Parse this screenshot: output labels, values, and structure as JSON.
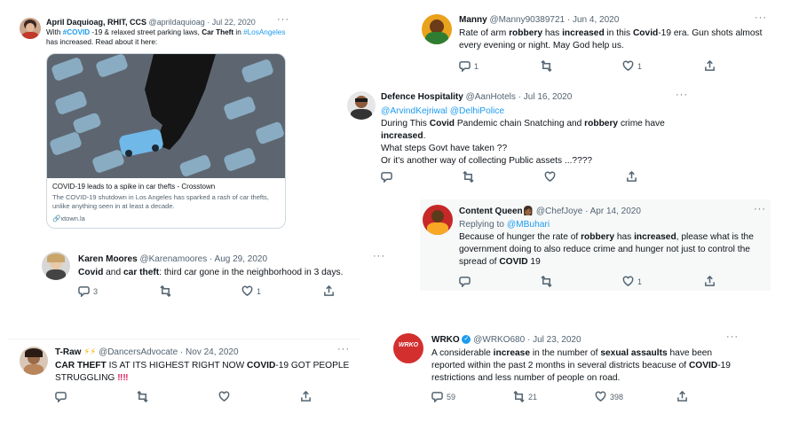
{
  "tweets": {
    "april": {
      "name": "April Daquioag, RHIT, CCS",
      "meta": "@aprildaquioag · Jul 22, 2020",
      "t1": "With ",
      "hashtag1": "#COVID",
      "t2": " -19 & relaxed street parking laws, ",
      "b1": "Car Theft",
      "t3": " in ",
      "hashtag2": "#LosAngeles",
      "line2": "has increased.  Read about it here:",
      "card_title": "COVID-19 leads to a spike in car thefts - Crosstown",
      "card_desc": "The COVID-19 shutdown in Los Angeles has sparked a rash of car thefts, unlike anything seen in at least a decade.",
      "card_domain": "xtown.la"
    },
    "manny": {
      "name": "Manny",
      "meta": "@Manny90389721 · Jun 4, 2020",
      "t1": "Rate of arm ",
      "b1": "robbery",
      "t2": " has ",
      "b2": "increased",
      "t3": " in this ",
      "b3": "Covid",
      "t4": "-19 era. Gun shots almost",
      "line2": "every evening or night. May God help us.",
      "replies": "1",
      "likes": "1"
    },
    "defence": {
      "name": "Defence Hospitality",
      "meta": "@AanHotels · Jul 16, 2020",
      "mentions": "@ArvindKejriwal @DelhiPolice",
      "t1": "During This ",
      "b1": "Covid",
      "t2": " Pandemic chain Snatching and ",
      "b2": "robbery",
      "t3": " crime have",
      "b3": "increased",
      "t4": ".",
      "line3": "What steps Govt have taken ??",
      "line4": "Or it's another way of collecting Public assets ...????"
    },
    "content": {
      "name": "Content Queen",
      "meta": "@ChefJoye · Apr 14, 2020",
      "replying": "Replying to ",
      "replying_to": "@MBuhari",
      "t1": "Because of hunger the rate of ",
      "b1": "robbery",
      "t2": " has ",
      "b2": "increased",
      "t3": ", please what is the",
      "line2": "government doing to also reduce crime and hunger not just to control the",
      "t4": "spread of ",
      "b3": "COVID",
      "t5": " 19",
      "likes": "1"
    },
    "karen": {
      "name": "Karen Moores",
      "meta": "@Karenamoores · Aug 29, 2020",
      "b1": "Covid",
      "t1": " and ",
      "b2": "car theft",
      "t2": ": third car gone in the neighborhood in 3 days.",
      "replies": "3",
      "likes": "1"
    },
    "traw": {
      "name": "T-Raw",
      "bolts": "⚡⚡",
      "meta": "@DancersAdvocate · Nov 24, 2020",
      "b1": "CAR THEFT",
      "t1": " IS AT ITS HIGHEST RIGHT NOW ",
      "b2": "COVID",
      "t2": "-19 GOT PEOPLE",
      "line2": "STRUGGLING ",
      "exclaim": "‼‼"
    },
    "wrko": {
      "name": "WRKO",
      "meta": "@WRKO680 · Jul 23, 2020",
      "logo": "WRKO",
      "t1": "A considerable ",
      "b1": "increase",
      "t2": " in the number of ",
      "b2": "sexual assaults",
      "t3": " have been",
      "line2": "reported within the past 2 months in several districts beacuse of ",
      "b3": "COVID",
      "t4": "-19",
      "line3": "restrictions and less number of people on road.",
      "replies": "59",
      "retweets": "21",
      "likes": "398"
    }
  },
  "colors": {
    "link": "#1d9bf0",
    "text": "#0f1419",
    "muted": "#536471"
  }
}
